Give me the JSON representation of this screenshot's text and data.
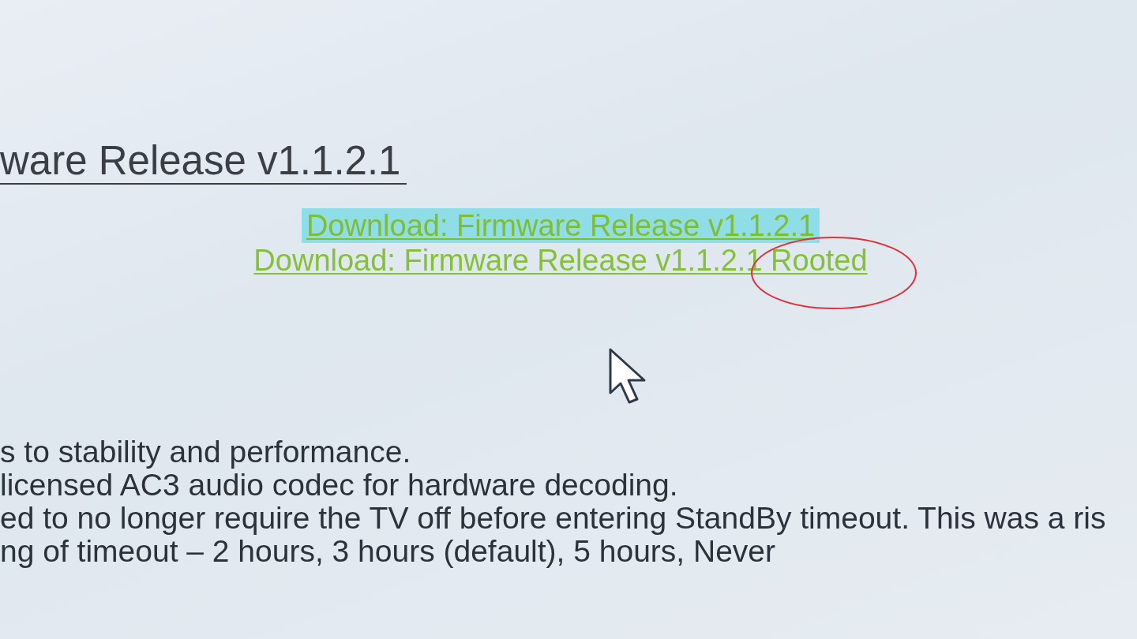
{
  "section": {
    "title": "ware Release v1.1.2.1"
  },
  "downloads": [
    {
      "label": "Download: Firmware Release v1.1.2.1",
      "selected": true
    },
    {
      "label": "Download: Firmware Release v1.1.2.1 Rooted",
      "selected": false
    }
  ],
  "notes": [
    "s to stability and performance.",
    "licensed AC3 audio codec for hardware decoding.",
    "ed to no longer require the TV off before entering StandBy timeout. This was a ris",
    "ng of timeout – 2 hours, 3 hours (default), 5 hours, Never"
  ]
}
